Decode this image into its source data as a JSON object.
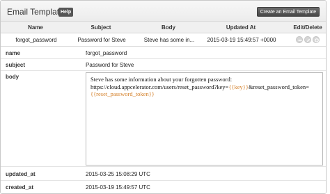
{
  "header": {
    "title": "Email Templates",
    "help_label": "Help",
    "create_button": "Create an Email Template"
  },
  "table": {
    "columns": [
      "Name",
      "Subject",
      "Body",
      "Updated At",
      "Edit/Delete"
    ],
    "row": {
      "name": "forgot_password",
      "subject": "Password for Steve",
      "body": "Steve has some in...",
      "updated_at": "2015-03-19 15:49:57 +0000"
    }
  },
  "details": {
    "name": {
      "label": "name",
      "value": "forgot_password"
    },
    "subject": {
      "label": "subject",
      "value": "Password for Steve"
    },
    "body": {
      "label": "body",
      "line1": "Steve has some information about your forgotten password:",
      "line2_prefix": "https://cloud.appcelerator.com/users/reset_password?key=",
      "line2_var": "{{key}}",
      "line2_suffix": "&reset_password_token=",
      "line3_var": "{{reset_password_token}}"
    },
    "updated_at": {
      "label": "updated_at",
      "value": "2015-03-25 15:08:29 UTC"
    },
    "created_at": {
      "label": "created_at",
      "value": "2015-03-19 15:49:57 UTC"
    }
  },
  "icons": {
    "delete": "minus-circle-icon",
    "edit": "pencil-icon",
    "settings": "gear-icon"
  }
}
